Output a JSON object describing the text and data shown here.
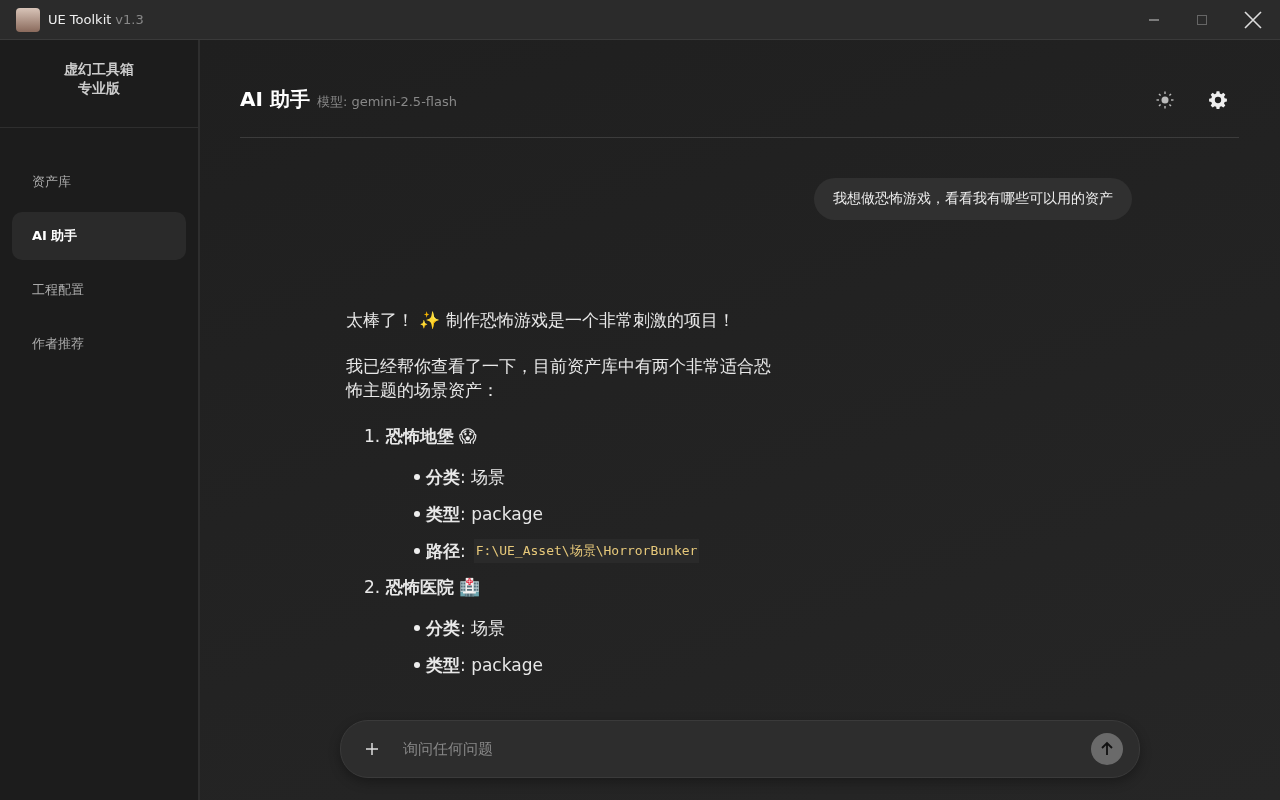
{
  "window": {
    "title": "UE Toolkit",
    "version": "v1.3"
  },
  "sidebar": {
    "brand": [
      "虚幻工具箱",
      "专业版"
    ],
    "items": [
      {
        "label": "资产库",
        "selected": false
      },
      {
        "label": "AI 助手",
        "selected": true
      },
      {
        "label": "工程配置",
        "selected": false
      },
      {
        "label": "作者推荐",
        "selected": false
      }
    ]
  },
  "header": {
    "title": "AI 助手",
    "model": "模型: gemini-2.5-flash"
  },
  "messages": [
    {
      "kind": "user",
      "text": "我想做恐怖游戏，看看我有哪些可以用的资产"
    },
    {
      "kind": "assistant",
      "paragraphs": [
        "太棒了！ ✨ 制作恐怖游戏是一个非常刺激的项目！",
        "我已经帮你查看了一下，目前资产库中有两个非常适合恐怖主题的场景资产："
      ],
      "items": [
        {
          "heading": "1. **恐怖地堡** 😱",
          "fields": [
            {
              "kind": "text",
              "text": "**分类**: 场景"
            },
            {
              "kind": "text",
              "text": "**类型**: package"
            },
            {
              "kind": "code",
              "label": "**路径**:",
              "value": "F:\\UE_Asset\\场景\\HorrorBunker"
            }
          ]
        },
        {
          "heading": "2. **恐怖医院** 🏥",
          "fields": [
            {
              "kind": "text",
              "text": "**分类**: 场景"
            },
            {
              "kind": "text",
              "text": "**类型**: package"
            }
          ]
        }
      ]
    }
  ],
  "composer": {
    "placeholder": "询问任何问题"
  }
}
